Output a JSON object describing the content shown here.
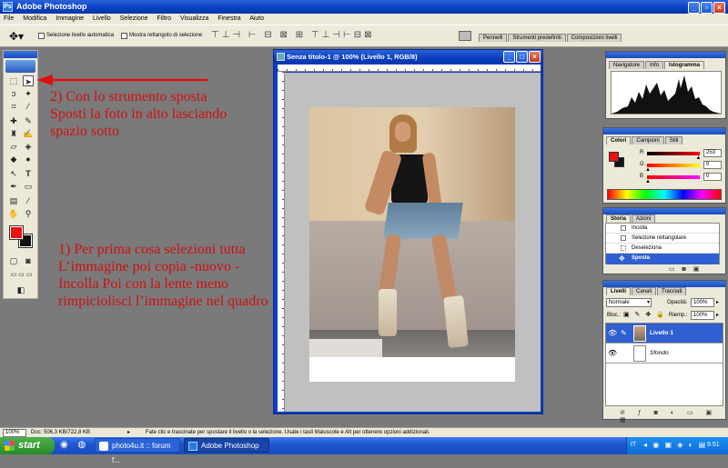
{
  "app": {
    "title": "Adobe Photoshop"
  },
  "menu": [
    "File",
    "Modifica",
    "Immagine",
    "Livello",
    "Selezione",
    "Filtro",
    "Visualizza",
    "Finestra",
    "Aiuto"
  ],
  "options_bar": {
    "auto_select_label": "Selezione livello automatica",
    "show_bounds_label": "Mostra rettangolo di selezione"
  },
  "palette_well": {
    "tabs": [
      "Pennelli",
      "Strumenti predefiniti",
      "Composizioni livelli"
    ]
  },
  "document": {
    "title": "Senza titolo-1 @ 100% (Livello 1, RGB/8)"
  },
  "annotations": {
    "note2_line1": "2) Con lo strumento sposta",
    "note2_line2": "Sposti la foto in alto lasciando",
    "note2_line3": "spazio sotto",
    "note1_line1": "1) Per prima cosa selezioni tutta",
    "note1_line2": "L’immagine poi copia -nuovo -",
    "note1_line3": "Incolla Poi con la lente meno",
    "note1_line4": "rimpiciolisci l’immagine nel quadro"
  },
  "navigator": {
    "tabs": [
      "Navigatore",
      "Info",
      "Istogramma"
    ],
    "active": "Istogramma"
  },
  "color_panel": {
    "tabs": [
      "Colori",
      "Campioni",
      "Stili"
    ],
    "r_label": "R",
    "g_label": "G",
    "b_label": "B",
    "r_value": "253",
    "g_value": "0",
    "b_value": "0",
    "r_level": 0.99,
    "g_level": 0.0,
    "b_level": 0.0
  },
  "history": {
    "tabs": [
      "Storia",
      "Azioni"
    ],
    "items": [
      "Incolla",
      "Selezione rettangolare",
      "Deseleziona",
      "Sposta"
    ]
  },
  "layers": {
    "tabs": [
      "Livelli",
      "Canali",
      "Tracciati"
    ],
    "blend_mode": "Normale",
    "opacity_label": "Opacità:",
    "opacity_value": "100%",
    "lock_label": "Bloc.:",
    "fill_label": "Riemp.:",
    "fill_value": "100%",
    "items": [
      {
        "name": "Livello 1",
        "selected": true
      },
      {
        "name": "Sfondo",
        "selected": false
      }
    ]
  },
  "status": {
    "zoom": "100%",
    "doc_info": "Doc: 506,3 KB/722,8 KB",
    "hint": "Fate clic e trascinate per spostare il livello o la selezione. Usate i tasti Maiuscole e Alt per ottenere opzioni addizionali."
  },
  "taskbar": {
    "start_label": "start",
    "items": [
      "photo4u.it :: forum f...",
      "Adobe Photoshop"
    ],
    "lang": "IT",
    "clock": "9.51"
  },
  "colors": {
    "foreground": "#ee1111",
    "background": "#111111",
    "annotation": "#d01010",
    "arrow": "#e01010"
  }
}
